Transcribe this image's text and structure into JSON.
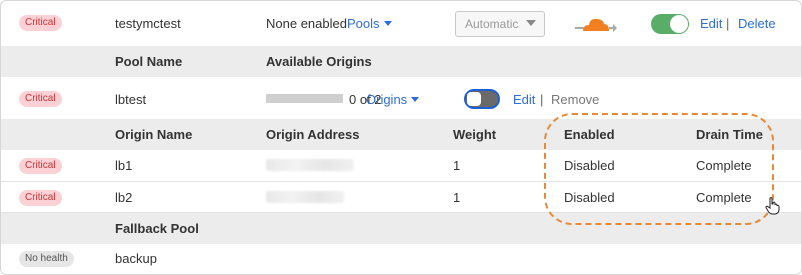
{
  "load_balancer": {
    "health": "Critical",
    "name": "testymctest",
    "pools_status": "None enabled",
    "pools_label": "Pools",
    "steering": "Automatic",
    "edit": "Edit",
    "delete": "Delete",
    "separator": "|"
  },
  "pool_table": {
    "col_pool_name": "Pool Name",
    "col_available_origins": "Available Origins"
  },
  "pool": {
    "health": "Critical",
    "name": "lbtest",
    "origins_count": "0 of 2",
    "origins_label": "Origins",
    "edit": "Edit",
    "remove": "Remove",
    "separator": "|"
  },
  "origin_table": {
    "col_origin_name": "Origin Name",
    "col_origin_address": "Origin Address",
    "col_weight": "Weight",
    "col_enabled": "Enabled",
    "col_drain_time": "Drain Time"
  },
  "origins": [
    {
      "health": "Critical",
      "name": "lb1",
      "weight": "1",
      "enabled": "Disabled",
      "drain_time": "Complete"
    },
    {
      "health": "Critical",
      "name": "lb2",
      "weight": "1",
      "enabled": "Disabled",
      "drain_time": "Complete"
    }
  ],
  "fallback": {
    "header": "Fallback Pool",
    "health": "No health",
    "name": "backup"
  },
  "colors": {
    "link": "#2c6ed6",
    "critical_bg": "#fbd1d6",
    "critical_text": "#cc3333",
    "toggle_on": "#5aac69",
    "highlight_dash": "#e8893a",
    "proxy_cloud": "#f38020"
  },
  "icons": {
    "proxy_status": "orange-cloud-icon",
    "pools_caret": "caret-down-icon",
    "origins_caret": "caret-down-icon",
    "cursor": "hand-pointer-icon"
  }
}
